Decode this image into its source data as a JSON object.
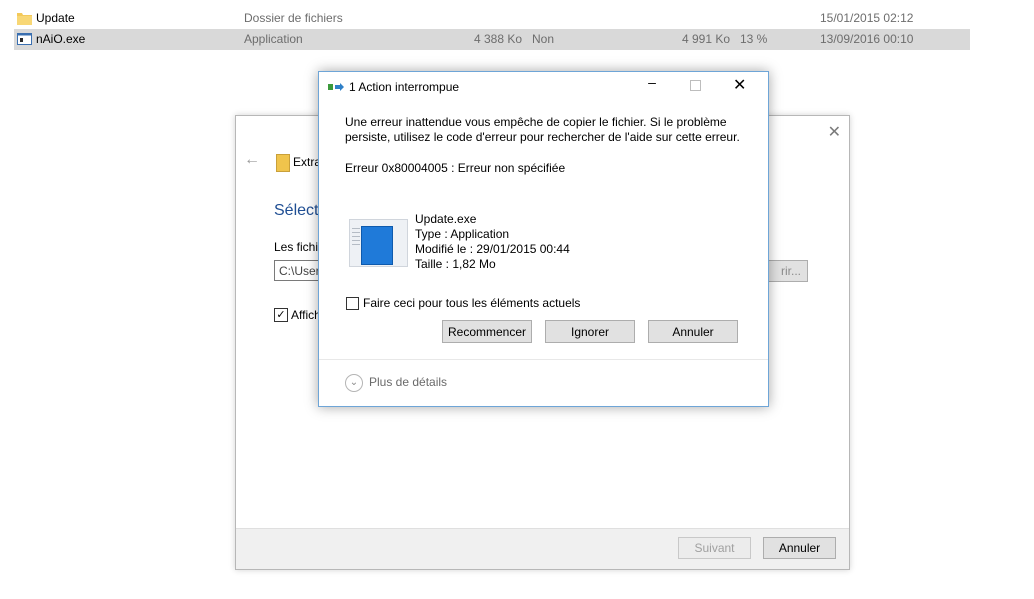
{
  "file_list": {
    "rows": [
      {
        "name": "Update",
        "icon": "folder-icon",
        "type": "Dossier de fichiers",
        "size": "",
        "compressed": "",
        "packed_size": "",
        "ratio": "",
        "date": "15/01/2015 02:12",
        "selected": false
      },
      {
        "name": "nAiO.exe",
        "icon": "exe-icon",
        "type": "Application",
        "size": "4 388 Ko",
        "compressed": "Non",
        "packed_size": "4 991 Ko",
        "ratio": "13 %",
        "date": "13/09/2016 00:10",
        "selected": true
      }
    ]
  },
  "wizard": {
    "title": "Extra",
    "heading": "Sélecti",
    "label": "Les fichi",
    "path": "C:\\User",
    "browse": "rir...",
    "checkbox_label": "Affich",
    "checkbox_checked": true,
    "next_label": "Suivant",
    "cancel_label": "Annuler"
  },
  "dialog": {
    "title": "1 Action interrompue",
    "message": "Une erreur inattendue vous empêche de copier le fichier. Si le problème persiste, utilisez le code d'erreur pour rechercher de l'aide sur cette erreur.",
    "error_code": "Erreur 0x80004005 : Erreur non spécifiée",
    "file": {
      "name": "Update.exe",
      "type": "Type : Application",
      "modified": "Modifié le : 29/01/2015 00:44",
      "size": "Taille : 1,82 Mo"
    },
    "checkbox_label": "Faire ceci pour tous les éléments actuels",
    "buttons": {
      "retry": "Recommencer",
      "ignore": "Ignorer",
      "cancel": "Annuler"
    },
    "details_label": "Plus de détails",
    "accent_color": "#6ea5d7"
  }
}
